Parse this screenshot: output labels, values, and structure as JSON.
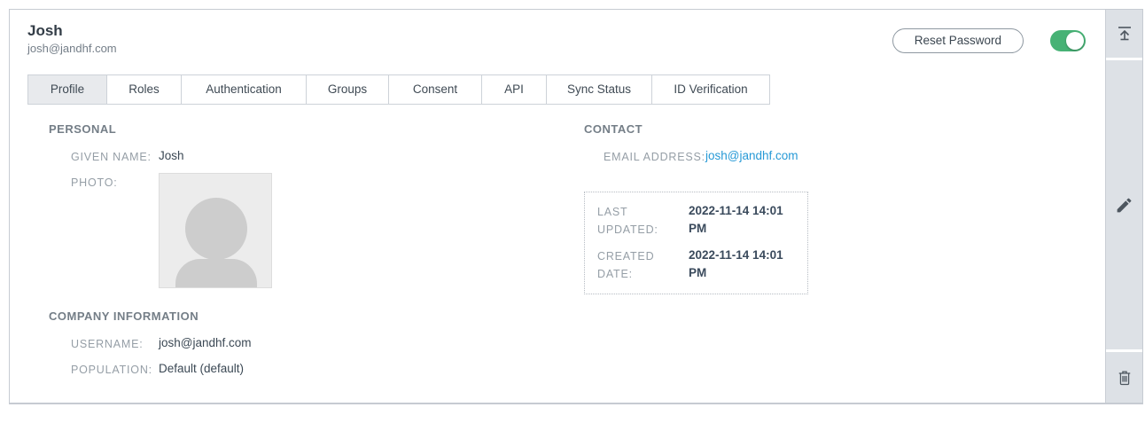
{
  "header": {
    "title": "Josh",
    "subtitle": "josh@jandhf.com",
    "reset_password_label": "Reset Password",
    "toggle": {
      "name": "user-enabled",
      "state": "on"
    }
  },
  "tabs": [
    {
      "label": "Profile",
      "active": true
    },
    {
      "label": "Roles",
      "active": false
    },
    {
      "label": "Authentication",
      "active": false
    },
    {
      "label": "Groups",
      "active": false
    },
    {
      "label": "Consent",
      "active": false
    },
    {
      "label": "API",
      "active": false
    },
    {
      "label": "Sync Status",
      "active": false
    },
    {
      "label": "ID Verification",
      "active": false
    }
  ],
  "profile": {
    "personal": {
      "title": "PERSONAL",
      "given_name_label": "GIVEN NAME:",
      "given_name": "Josh",
      "photo_label": "PHOTO:"
    },
    "company": {
      "title": "COMPANY INFORMATION",
      "username_label": "USERNAME:",
      "username": "josh@jandhf.com",
      "population_label": "POPULATION:",
      "population": "Default (default)"
    },
    "contact": {
      "title": "CONTACT",
      "email_label": "EMAIL ADDRESS:",
      "email": "josh@jandhf.com"
    },
    "metadata": {
      "last_updated_label": "LAST UPDATED:",
      "last_updated": "2022-11-14 14:01 PM",
      "created_date_label": "CREATED DATE:",
      "created_date": "2022-11-14 14:01 PM"
    }
  },
  "sidebar": {
    "icons": [
      {
        "name": "scroll-to-top-icon"
      },
      {
        "name": "edit-icon"
      },
      {
        "name": "delete-icon"
      }
    ]
  },
  "colors": {
    "link_blue": "#2699D6",
    "toggle_green": "#47B275",
    "active_tab_bg": "#E8EAED",
    "rail_bg": "#DDE1E6",
    "value_text": "#3B4854",
    "label_text": "#959EA6"
  }
}
